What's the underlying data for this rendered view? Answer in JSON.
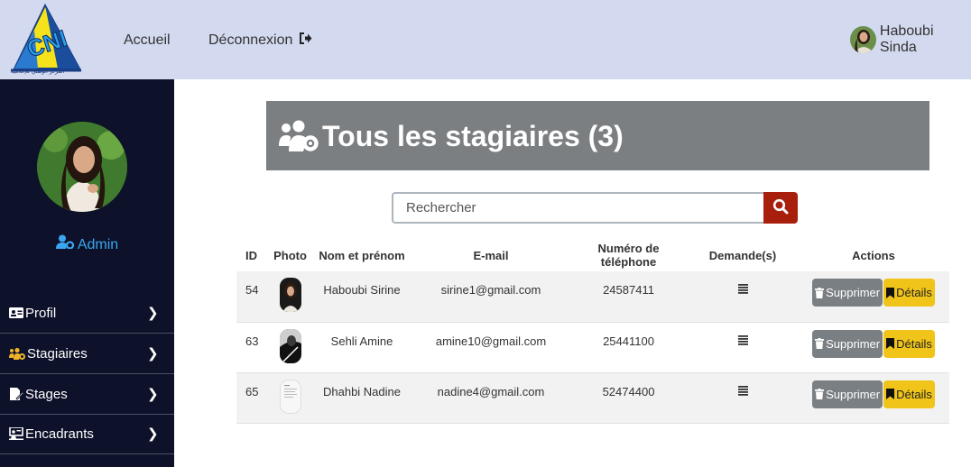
{
  "navbar": {
    "logo_text": "CNI",
    "logo_caption": "المركز الوطني للإعلامية",
    "home_label": "Accueil",
    "logout_label": "Déconnexion",
    "user_name": "Haboubi Sinda"
  },
  "sidebar": {
    "role_label": "Admin",
    "items": [
      {
        "label": "Profil",
        "icon": "id-card-icon"
      },
      {
        "label": "Stagiaires",
        "icon": "users-cog-icon"
      },
      {
        "label": "Stages",
        "icon": "file-signature-icon"
      },
      {
        "label": "Encadrants",
        "icon": "chalkboard-teacher-icon"
      }
    ]
  },
  "main": {
    "title": "Tous les stagiaires (3)",
    "search_placeholder": "Rechercher",
    "columns": [
      "ID",
      "Photo",
      "Nom et prénom",
      "E-mail",
      "Numéro de téléphone",
      "Demande(s)",
      "Actions"
    ],
    "rows": [
      {
        "id": "54",
        "name": "Haboubi Sirine",
        "email": "sirine1@gmail.com",
        "phone": "24587411",
        "photo": "person-photo"
      },
      {
        "id": "63",
        "name": "Sehli Amine",
        "email": "amine10@gmail.com",
        "phone": "25441100",
        "photo": "person-photo"
      },
      {
        "id": "65",
        "name": "Dhahbi Nadine",
        "email": "nadine4@gmail.com",
        "phone": "52474400",
        "photo": "document-photo"
      }
    ],
    "delete_label": "Supprimer",
    "details_label": "Détails"
  },
  "colors": {
    "navbar_bg": "#d3d9ef",
    "sidebar_bg": "#0d1129",
    "role_color": "#3aa8f0",
    "stagiaires_icon": "#f0b429",
    "title_bg": "#7b7f81",
    "search_button": "#a8200d",
    "delete_button": "#7a7f84",
    "details_button": "#f0c419"
  }
}
